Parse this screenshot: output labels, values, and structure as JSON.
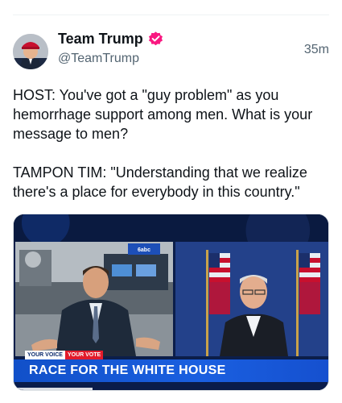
{
  "post": {
    "display_name": "Team Trump",
    "handle": "@TeamTrump",
    "timestamp": "35m",
    "text": "HOST: You've got a \"guy problem\" as you hemorrhage support among men. What is your message to men?\n\nTAMPON TIM: \"Understanding that we realize there's a place for everybody in this country.\""
  },
  "media": {
    "tag_left": "YOUR VOICE",
    "tag_right": "YOUR VOTE",
    "headline": "RACE FOR THE WHITE HOUSE",
    "logo_text": "6abc",
    "progress_fraction": 0.25
  },
  "colors": {
    "verified": "#f91880",
    "headline_bar": "#1a5fe0",
    "tag_red": "#e21b2b"
  },
  "icons": {
    "verified": "verified-badge-icon"
  }
}
